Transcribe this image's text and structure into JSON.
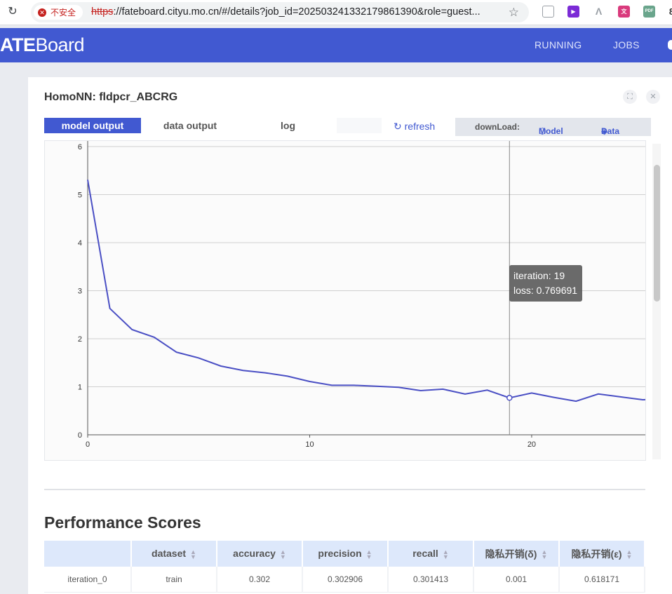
{
  "browser": {
    "security_label": "不安全",
    "url_protocol": "https",
    "url_rest": "://fateboard.cityu.mo.cn/#/details?job_id=202503241332179861390&role=guest..."
  },
  "header": {
    "logo_bold": "ATE",
    "logo_rest": "Board",
    "nav": [
      "RUNNING",
      "JOBS"
    ]
  },
  "panel": {
    "title": "HomoNN: fldpcr_ABCRG",
    "tabs": [
      "model output",
      "data output",
      "log"
    ],
    "refresh_label": "refresh",
    "download_label": "downLoad:",
    "download_model": "Model",
    "download_data": "Data"
  },
  "chart_data": {
    "type": "line",
    "x_name": "iteration",
    "y_name": "loss",
    "xlim": [
      0,
      25.5
    ],
    "ylim": [
      0,
      6
    ],
    "x_ticks": [
      "0",
      "10",
      "20"
    ],
    "y_ticks": [
      "0",
      "1",
      "2",
      "3",
      "4",
      "5",
      "6"
    ],
    "grid": true,
    "x": [
      0,
      1,
      2,
      3,
      4,
      5,
      6,
      7,
      8,
      9,
      10,
      11,
      12,
      13,
      14,
      15,
      16,
      17,
      18,
      19,
      20,
      21,
      22,
      23,
      24,
      25,
      26
    ],
    "y": [
      5.31,
      2.63,
      2.19,
      2.03,
      1.72,
      1.6,
      1.43,
      1.34,
      1.29,
      1.22,
      1.11,
      1.03,
      1.03,
      1.01,
      0.99,
      0.92,
      0.95,
      0.85,
      0.93,
      0.769691,
      0.87,
      0.78,
      0.7,
      0.85,
      0.79,
      0.73,
      0.74
    ],
    "series_color": "#4a4fc4",
    "tooltip": {
      "iteration_label": "iteration: 19",
      "loss_label": "loss: 0.769691",
      "x": 19,
      "y": 0.769691
    }
  },
  "performance": {
    "title": "Performance Scores",
    "columns": [
      "",
      "dataset",
      "accuracy",
      "precision",
      "recall",
      "隐私开销(δ)",
      "隐私开销(ε)"
    ],
    "rows": [
      [
        "iteration_0",
        "train",
        "0.302",
        "0.302906",
        "0.301413",
        "0.001",
        "0.618171"
      ]
    ]
  }
}
